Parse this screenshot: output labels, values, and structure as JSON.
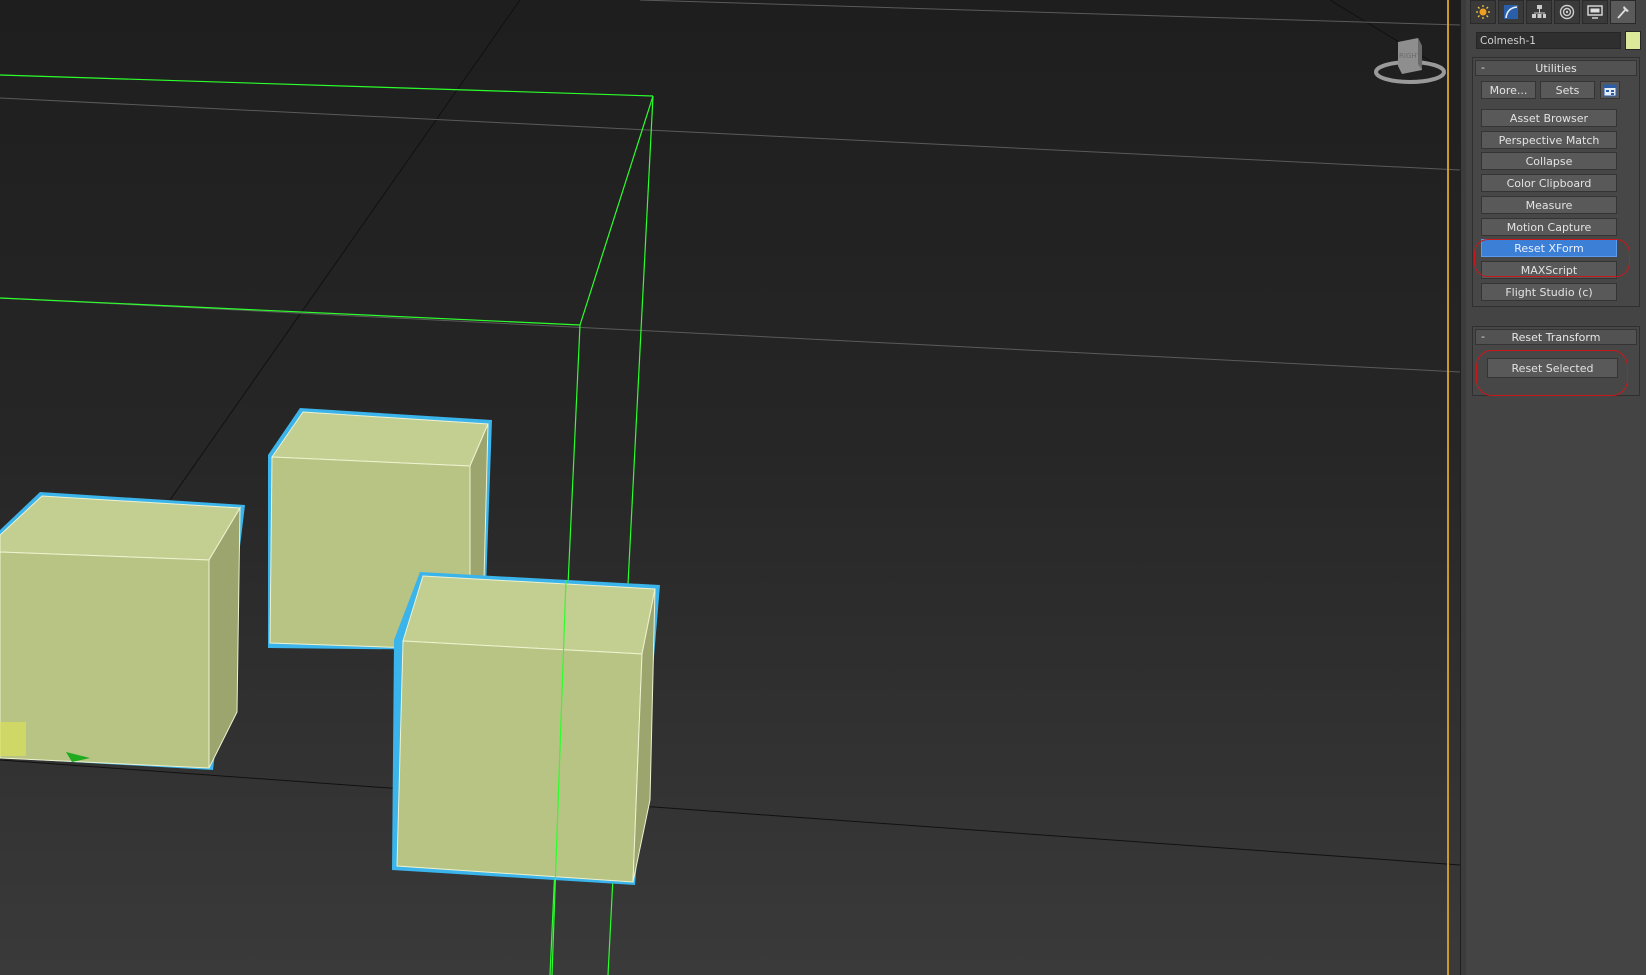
{
  "command_panel": {
    "tabs": [
      {
        "name": "create-tab",
        "icon": "sun-icon"
      },
      {
        "name": "modify-tab",
        "icon": "curve-icon"
      },
      {
        "name": "hierarchy-tab",
        "icon": "hierarchy-icon"
      },
      {
        "name": "motion-tab",
        "icon": "motion-icon"
      },
      {
        "name": "display-tab",
        "icon": "monitor-icon"
      },
      {
        "name": "utilities-tab",
        "icon": "hammer-icon"
      }
    ],
    "object_name": "Colmesh-1",
    "object_color": "#dce89a"
  },
  "utilities": {
    "title": "Utilities",
    "collapse": "-",
    "more_label": "More...",
    "sets_label": "Sets",
    "configure_icon": "configure-sets-icon",
    "buttons": [
      "Asset Browser",
      "Perspective Match",
      "Collapse",
      "Color Clipboard",
      "Measure",
      "Motion Capture",
      "Reset XForm",
      "MAXScript",
      "Flight Studio (c)"
    ],
    "active_button": "Reset XForm"
  },
  "reset_transform": {
    "title": "Reset Transform",
    "collapse": "-",
    "reset_selected_label": "Reset Selected"
  },
  "viewport": {
    "viewcube_label": "RIGHT",
    "object_color": "#b8c484",
    "selection_color": "#3ab4ea",
    "grid_helper_color": "#2cff2c"
  }
}
